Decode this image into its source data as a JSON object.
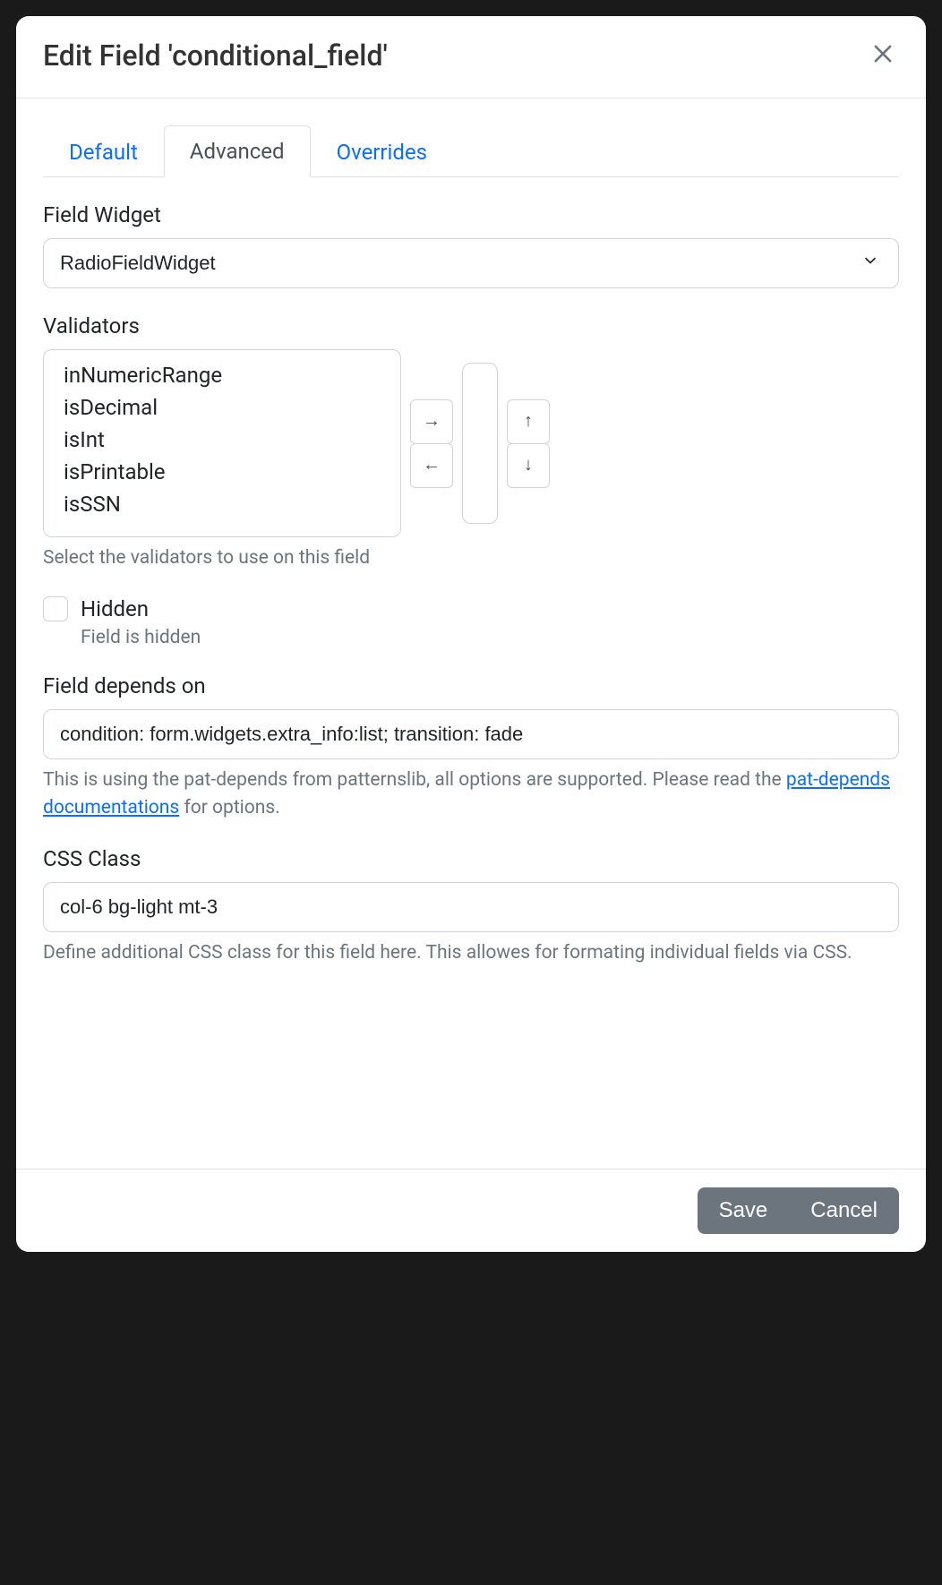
{
  "header": {
    "title": "Edit Field 'conditional_field'"
  },
  "tabs": {
    "default": "Default",
    "advanced": "Advanced",
    "overrides": "Overrides",
    "active": "advanced"
  },
  "field_widget": {
    "label": "Field Widget",
    "value": "RadioFieldWidget"
  },
  "validators": {
    "label": "Validators",
    "options": [
      "inNumericRange",
      "isDecimal",
      "isInt",
      "isPrintable",
      "isSSN"
    ],
    "help": "Select the validators to use on this field"
  },
  "hidden": {
    "label": "Hidden",
    "sub": "Field is hidden",
    "checked": false
  },
  "depends_on": {
    "label": "Field depends on",
    "value": "condition: form.widgets.extra_info:list; transition: fade",
    "help_pre": "This is using the pat-depends from patternslib, all options are supported. Please read the ",
    "help_link": "pat-depends documentations",
    "help_post": " for options."
  },
  "css_class": {
    "label": "CSS Class",
    "value": "col-6 bg-light mt-3",
    "help": "Define additional CSS class for this field here. This allowes for formating individual fields via CSS."
  },
  "footer": {
    "save": "Save",
    "cancel": "Cancel"
  }
}
